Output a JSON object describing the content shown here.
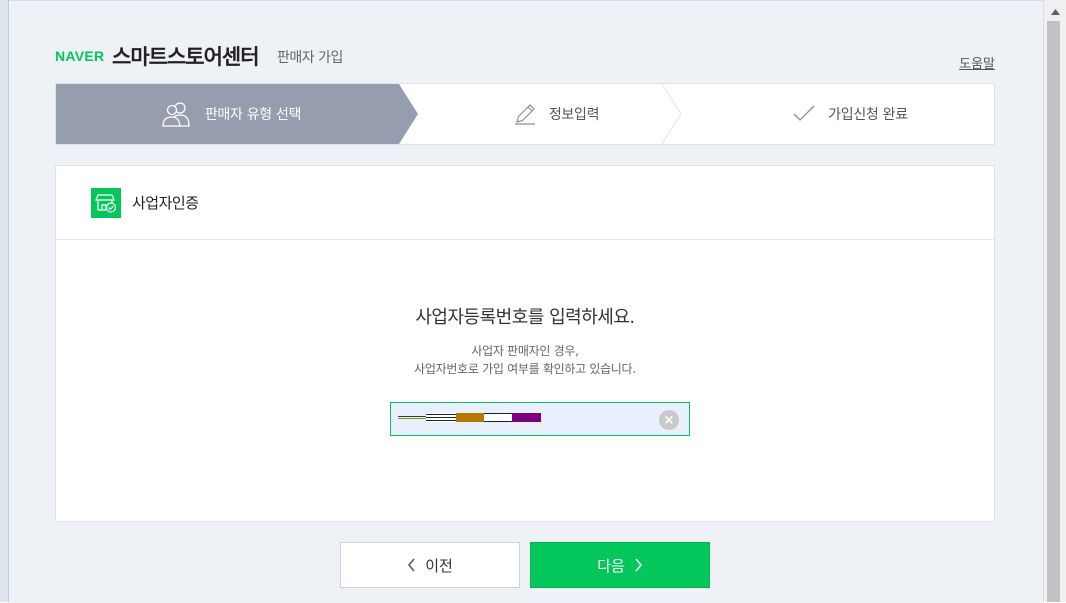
{
  "header": {
    "logo": "NAVER",
    "title": "스마트스토어센터",
    "subtitle": "판매자 가입",
    "help_label": "도움말"
  },
  "steps": [
    {
      "label": "판매자 유형 선택",
      "icon": "users-icon",
      "state": "active"
    },
    {
      "label": "정보입력",
      "icon": "pencil-icon",
      "state": "pending"
    },
    {
      "label": "가입신청 완료",
      "icon": "check-icon",
      "state": "pending"
    }
  ],
  "card": {
    "title": "사업자인증",
    "badge_icon": "store-check-icon",
    "prompt": "사업자등록번호를 입력하세요.",
    "desc_line1": "사업자 판매자인 경우,",
    "desc_line2": "사업자번호로 가입 여부를 확인하고 있습니다.",
    "input_value_redacted": true,
    "clear_icon": "clear-icon"
  },
  "buttons": {
    "prev_label": "이전",
    "next_label": "다음"
  },
  "colors": {
    "brand_green": "#03c75a",
    "step_active": "#959dae",
    "window_bg": "#eef1f5",
    "input_bg": "#e8f0fd"
  }
}
